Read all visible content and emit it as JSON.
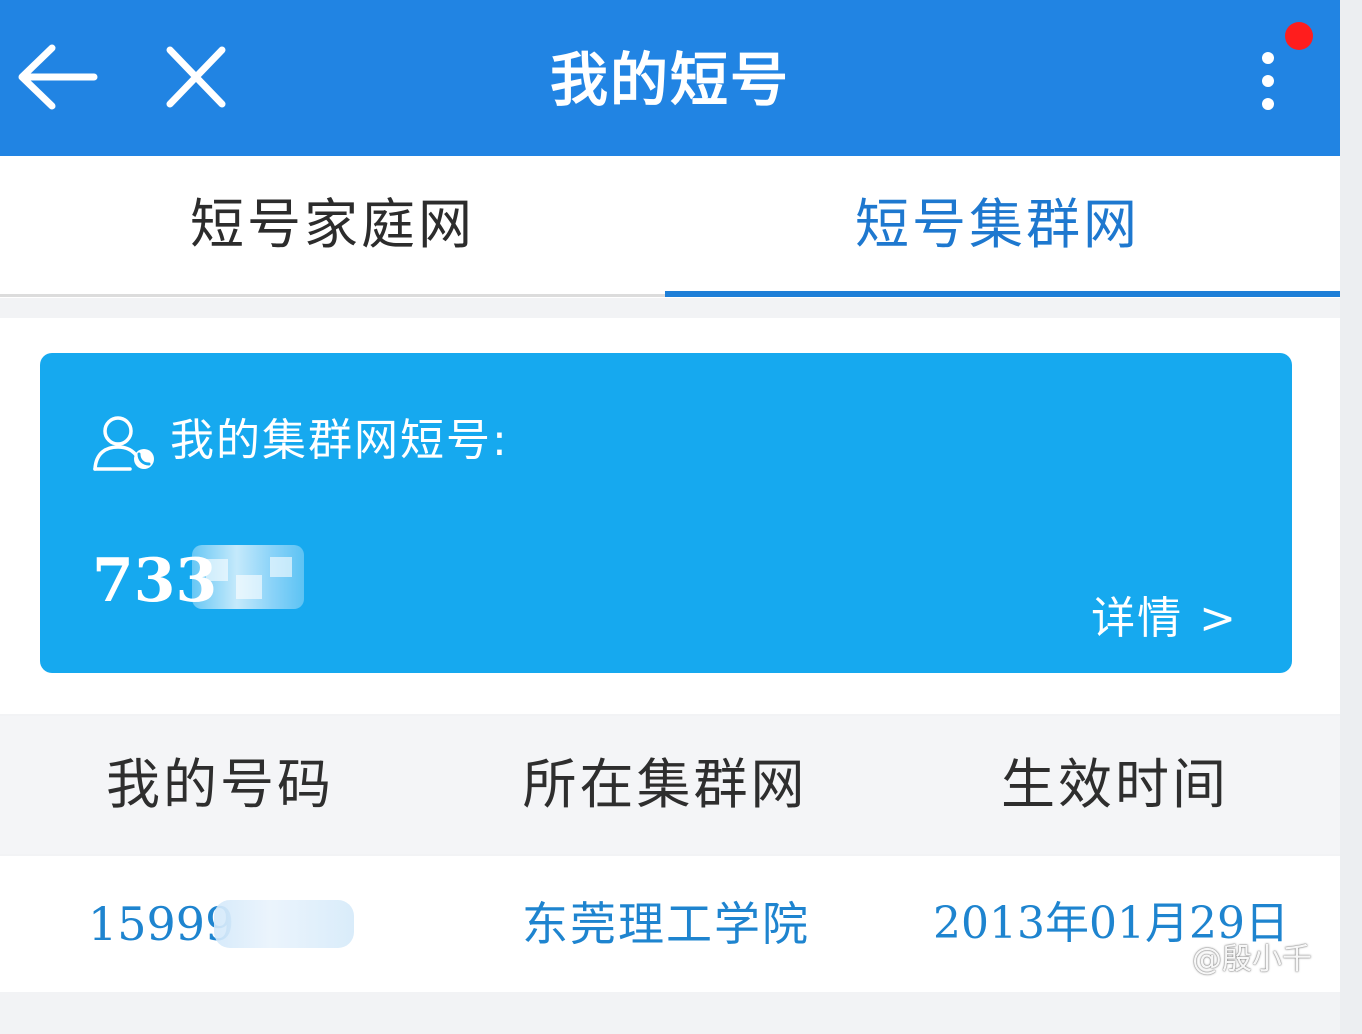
{
  "header": {
    "title": "我的短号",
    "back_icon": "back-arrow-icon",
    "close_icon": "close-icon",
    "more_icon": "more-vertical-icon",
    "notification_dot_color": "#ff1d1d",
    "bar_color": "#2184e3"
  },
  "tabs": [
    {
      "label": "短号家庭网",
      "active": false
    },
    {
      "label": "短号集群网",
      "active": true
    }
  ],
  "card": {
    "icon": "user-phone-icon",
    "label": "我的集群网短号:",
    "short_number": "733",
    "details_label": "详情 >",
    "color": "#16a9ef"
  },
  "table": {
    "headers": [
      "我的号码",
      "所在集群网",
      "生效时间"
    ],
    "rows": [
      {
        "number": "15999",
        "network": "东莞理工学院",
        "effective_date": "2013年01月29日"
      }
    ]
  },
  "watermark": {
    "icon": "weibo-icon",
    "text": "@殷小千"
  }
}
